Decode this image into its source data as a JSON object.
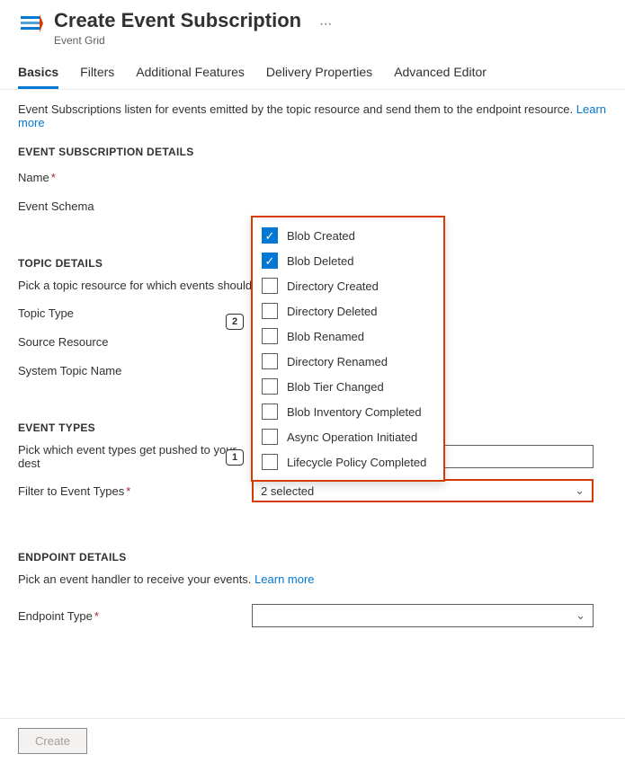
{
  "header": {
    "title": "Create Event Subscription",
    "subtitle": "Event Grid"
  },
  "tabs": {
    "items": [
      {
        "label": "Basics",
        "active": true
      },
      {
        "label": "Filters",
        "active": false
      },
      {
        "label": "Additional Features",
        "active": false
      },
      {
        "label": "Delivery Properties",
        "active": false
      },
      {
        "label": "Advanced Editor",
        "active": false
      }
    ]
  },
  "intro": {
    "text": "Event Subscriptions listen for events emitted by the topic resource and send them to the endpoint resource.",
    "learn_more": "Learn more"
  },
  "sections": {
    "subscription": {
      "heading": "EVENT SUBSCRIPTION DETAILS",
      "name_label": "Name",
      "schema_label": "Event Schema"
    },
    "topic": {
      "heading": "TOPIC DETAILS",
      "desc": "Pick a topic resource for which events should b",
      "type_label": "Topic Type",
      "source_label": "Source Resource",
      "system_label": "System Topic Name"
    },
    "event_types": {
      "heading": "EVENT TYPES",
      "desc": "Pick which event types get pushed to your dest",
      "filter_label": "Filter to Event Types",
      "selected_text": "2 selected",
      "options": [
        {
          "label": "Blob Created",
          "checked": true
        },
        {
          "label": "Blob Deleted",
          "checked": true
        },
        {
          "label": "Directory Created",
          "checked": false
        },
        {
          "label": "Directory Deleted",
          "checked": false
        },
        {
          "label": "Blob Renamed",
          "checked": false
        },
        {
          "label": "Directory Renamed",
          "checked": false
        },
        {
          "label": "Blob Tier Changed",
          "checked": false
        },
        {
          "label": "Blob Inventory Completed",
          "checked": false
        },
        {
          "label": "Async Operation Initiated",
          "checked": false
        },
        {
          "label": "Lifecycle Policy Completed",
          "checked": false
        }
      ]
    },
    "endpoint": {
      "heading": "ENDPOINT DETAILS",
      "desc": "Pick an event handler to receive your events.",
      "learn_more": "Learn more",
      "type_label": "Endpoint Type"
    }
  },
  "annotations": {
    "badge1": "1",
    "badge2": "2"
  },
  "footer": {
    "create": "Create"
  }
}
